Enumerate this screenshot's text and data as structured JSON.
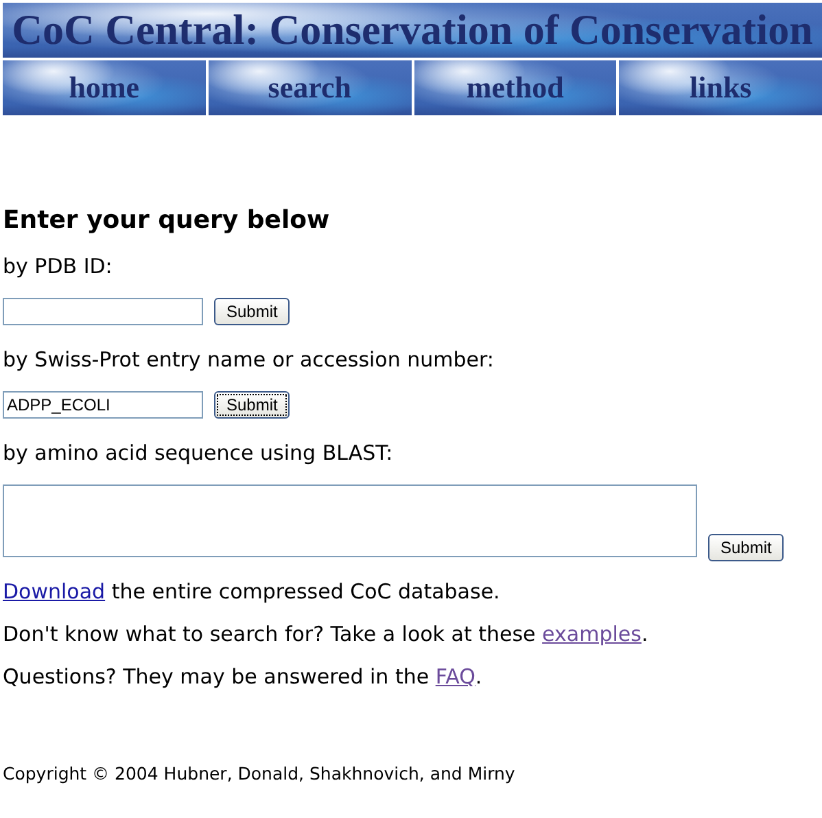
{
  "banner": {
    "title": "CoC Central: Conservation of Conservation"
  },
  "nav": [
    {
      "label": "home"
    },
    {
      "label": "search"
    },
    {
      "label": "method"
    },
    {
      "label": "links"
    }
  ],
  "heading": "Enter your query below",
  "queries": [
    {
      "label": "by PDB ID:",
      "kind": "input",
      "button": "Submit",
      "focused": false
    },
    {
      "label": "by Swiss-Prot entry name or accession number:",
      "kind": "input",
      "value": "ADPP_ECOLI",
      "button": "Submit",
      "focused": true
    },
    {
      "label": "by amino acid sequence using BLAST:",
      "kind": "textarea",
      "button": "Submit",
      "focused": false
    }
  ],
  "paragraphs": [
    [
      {
        "link": "Download",
        "visited": false
      },
      {
        "text": " the entire compressed CoC database."
      }
    ],
    [
      {
        "text": "Don't know what to search for? Take a look at these "
      },
      {
        "link": "examples",
        "visited": true
      },
      {
        "text": "."
      }
    ],
    [
      {
        "text": "Questions? They may be answered in the "
      },
      {
        "link": "FAQ",
        "visited": true
      },
      {
        "text": "."
      }
    ]
  ],
  "copyright": "Copyright © 2004 Hubner, Donald, Shakhnovich, and Mirny"
}
